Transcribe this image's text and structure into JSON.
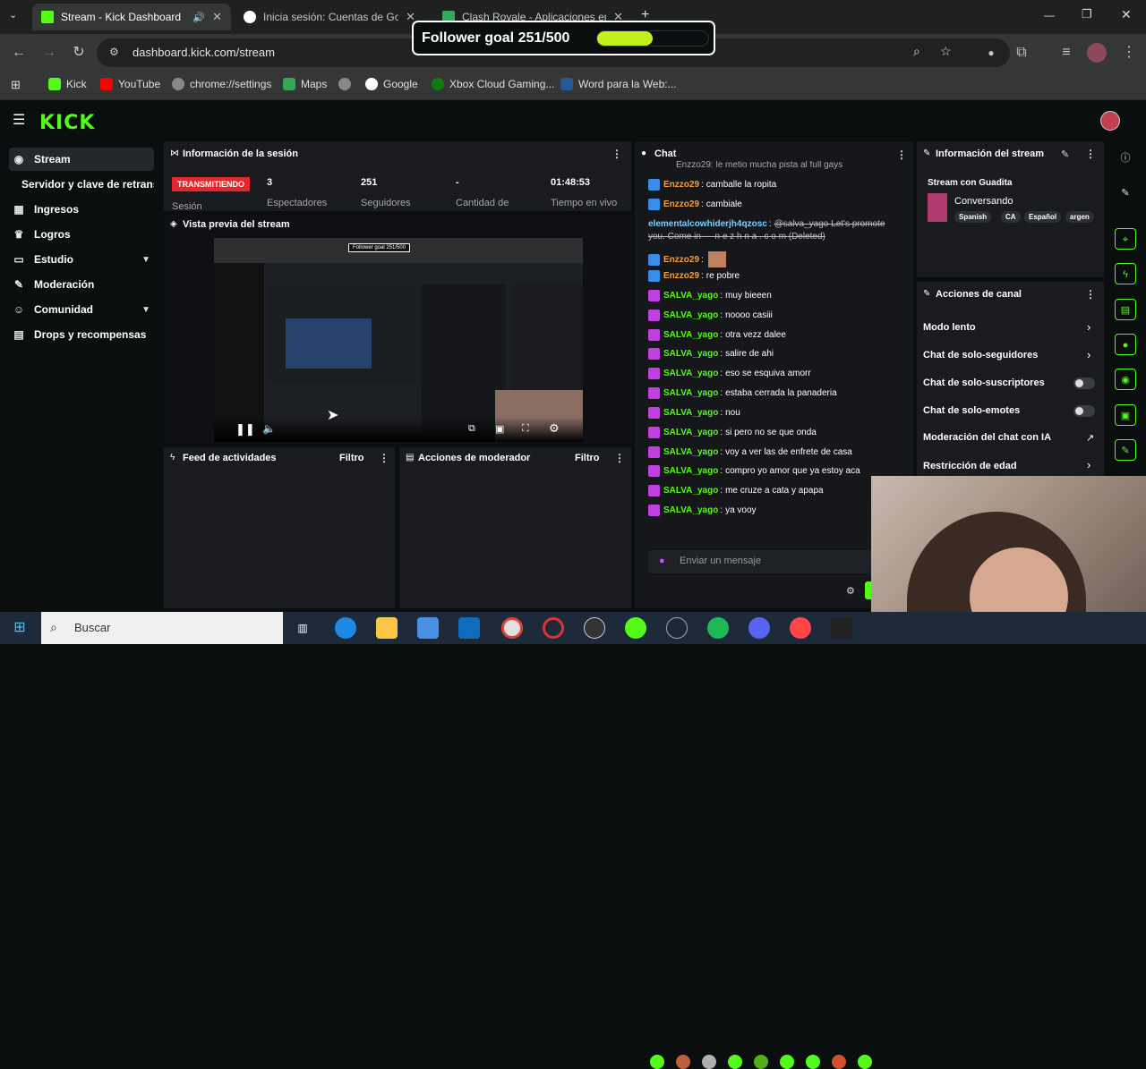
{
  "browser": {
    "tabs": [
      {
        "label": "Stream - Kick Dashboard",
        "active": true
      },
      {
        "label": "Inicia sesión: Cuentas de Google",
        "active": false
      },
      {
        "label": "Clash Royale - Aplicaciones en...",
        "active": false
      }
    ],
    "new_tab": "+",
    "url": "dashboard.kick.com/stream",
    "bookmarks": [
      "Kick",
      "YouTube",
      "chrome://settings",
      "Maps",
      "Google",
      "Xbox Cloud Gaming...",
      "Word para la Web:..."
    ]
  },
  "overlay": {
    "follower_goal": "Follower goal 251/500",
    "progress": 0.502
  },
  "sidebar": {
    "items": [
      {
        "label": "Stream",
        "icon": "broadcast-icon"
      },
      {
        "label": "Servidor y clave de retransmisión",
        "icon": ""
      },
      {
        "label": "Ingresos",
        "icon": "chart-icon"
      },
      {
        "label": "Logros",
        "icon": "trophy-icon"
      },
      {
        "label": "Estudio",
        "icon": "studio-icon"
      },
      {
        "label": "Moderación",
        "icon": "wrench-icon"
      },
      {
        "label": "Comunidad",
        "icon": "people-icon"
      },
      {
        "label": "Drops y recompensas",
        "icon": "gift-icon"
      }
    ]
  },
  "session": {
    "title": "Información de la sesión",
    "live_badge": "TRANSMITIENDO",
    "session_label": "Sesión",
    "stats": [
      {
        "value": "3",
        "label": "Espectadores"
      },
      {
        "value": "251",
        "label": "Seguidores"
      },
      {
        "value": "-",
        "label": "Cantidad de"
      },
      {
        "value": "01:48:53",
        "label": "Tiempo en vivo"
      }
    ]
  },
  "preview": {
    "title": "Vista previa del stream",
    "mini_goal": "Follower goal 251/500"
  },
  "activity": {
    "title": "Feed de actividades",
    "filter": "Filtro"
  },
  "modactions": {
    "title": "Acciones de moderador",
    "filter": "Filtro"
  },
  "chat": {
    "title": "Chat",
    "top_cut": "Enzzo29: le metio mucha pista al full gays",
    "messages": [
      {
        "user": "Enzzo29",
        "text": "camballe la ropita",
        "color": "#f0a040",
        "badge": "#3b8ee8"
      },
      {
        "user": "Enzzo29",
        "text": "cambiale",
        "color": "#f0a040",
        "badge": "#3b8ee8"
      },
      {
        "user": "elementalcowhiderjh4qzosc",
        "text": "@salva_yago Let's promote you. Come in — n e z h n a . c o m (Deleted)",
        "color": "#7ad0ff",
        "badge": ""
      },
      {
        "user": "Enzzo29",
        "text": "",
        "color": "#f0a040",
        "badge": "#3b8ee8"
      },
      {
        "user": "Enzzo29",
        "text": "re pobre",
        "color": "#f0a040",
        "badge": "#3b8ee8"
      },
      {
        "user": "SALVA_yago",
        "text": "muy bieeen",
        "color": "#53fc18",
        "badge": "#c040e0"
      },
      {
        "user": "SALVA_yago",
        "text": "noooo casiii",
        "color": "#53fc18",
        "badge": "#c040e0"
      },
      {
        "user": "SALVA_yago",
        "text": "otra vezz dalee",
        "color": "#53fc18",
        "badge": "#c040e0"
      },
      {
        "user": "SALVA_yago",
        "text": "salire de ahi",
        "color": "#53fc18",
        "badge": "#c040e0"
      },
      {
        "user": "SALVA_yago",
        "text": "eso se esquiva amorr",
        "color": "#53fc18",
        "badge": "#c040e0"
      },
      {
        "user": "SALVA_yago",
        "text": "estaba cerrada la panaderia",
        "color": "#53fc18",
        "badge": "#c040e0"
      },
      {
        "user": "SALVA_yago",
        "text": "nou",
        "color": "#53fc18",
        "badge": "#c040e0"
      },
      {
        "user": "SALVA_yago",
        "text": "si pero no se que onda",
        "color": "#53fc18",
        "badge": "#c040e0"
      },
      {
        "user": "SALVA_yago",
        "text": "voy a ver las de enfrete de casa",
        "color": "#53fc18",
        "badge": "#c040e0"
      },
      {
        "user": "SALVA_yago",
        "text": "compro yo amor que ya estoy aca",
        "color": "#53fc18",
        "badge": "#c040e0"
      },
      {
        "user": "SALVA_yago",
        "text": "me cruze a cata y apapa",
        "color": "#53fc18",
        "badge": "#c040e0"
      },
      {
        "user": "SALVA_yago",
        "text": "ya vooy",
        "color": "#53fc18",
        "badge": "#c040e0"
      }
    ],
    "input_placeholder": "Enviar un mensaje"
  },
  "stream_info": {
    "title": "Información del stream",
    "stream_title": "Stream con Guadita",
    "category": "Conversando",
    "tags": [
      "Spanish",
      "CA",
      "Español",
      "argen"
    ]
  },
  "channel_actions": {
    "title": "Acciones de canal",
    "rows": [
      {
        "label": "Modo lento",
        "control": "chevron"
      },
      {
        "label": "Chat de solo-seguidores",
        "control": "chevron"
      },
      {
        "label": "Chat de solo-suscriptores",
        "control": "toggle"
      },
      {
        "label": "Chat de solo-emotes",
        "control": "toggle"
      },
      {
        "label": "Moderación del chat con IA",
        "control": "external"
      },
      {
        "label": "Restricción de edad",
        "control": "chevron"
      }
    ]
  },
  "taskbar": {
    "search_placeholder": "Buscar"
  },
  "colors": {
    "kick_green": "#53fc18",
    "live_red": "#e5262b",
    "panel": "#191b1f",
    "background": "#0b0e0f"
  }
}
